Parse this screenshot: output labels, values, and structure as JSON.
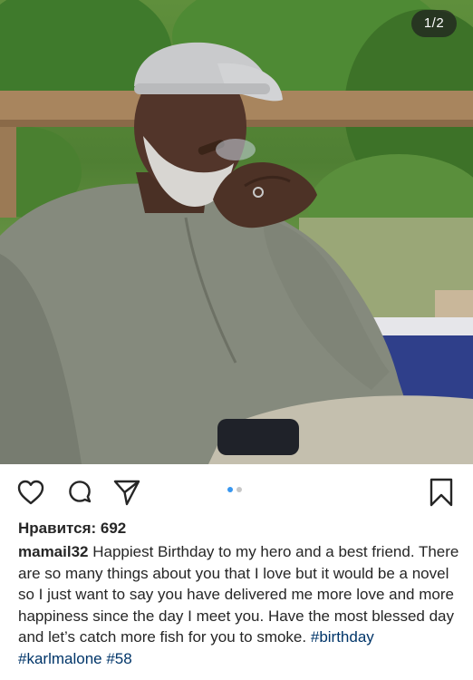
{
  "post": {
    "image_counter": "1/2",
    "carousel": {
      "total": 2,
      "current": 1
    },
    "actions": {
      "like_icon": "heart-icon",
      "comment_icon": "comment-icon",
      "share_icon": "paper-plane-icon",
      "save_icon": "bookmark-icon"
    },
    "likes_text": "Нравится: 692",
    "caption": {
      "username": "mamail32",
      "text": "Happiest Birthday to my hero and a best friend. There are so many things about you that I love but it would be a novel so I just want to say you have delivered me more love and more happiness since the day I meet you. Have the most blessed day and let’s catch more fish for you to smoke.",
      "hashtags": [
        "#birthday",
        "#karlmalone",
        "#58"
      ]
    },
    "colors": {
      "accent": "#3897f0",
      "hashtag": "#003569",
      "text": "#262626"
    }
  }
}
